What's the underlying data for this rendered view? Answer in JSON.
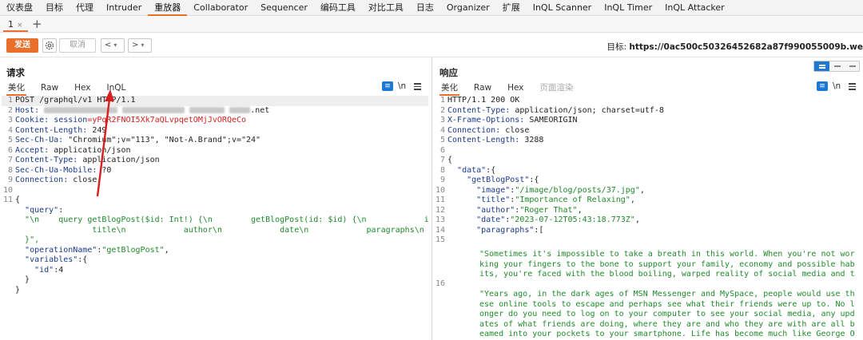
{
  "menu": [
    {
      "label": "仪表盘"
    },
    {
      "label": "目标"
    },
    {
      "label": "代理"
    },
    {
      "label": "Intruder"
    },
    {
      "label": "重放器",
      "active": true
    },
    {
      "label": "Collaborator"
    },
    {
      "label": "Sequencer"
    },
    {
      "label": "编码工具"
    },
    {
      "label": "对比工具"
    },
    {
      "label": "日志"
    },
    {
      "label": "Organizer"
    },
    {
      "label": "扩展"
    },
    {
      "label": "InQL Scanner"
    },
    {
      "label": "InQL Timer"
    },
    {
      "label": "InQL Attacker"
    }
  ],
  "request_tabs": {
    "tab1": "1",
    "close": "×",
    "add": "+"
  },
  "toolbar": {
    "send": "发送",
    "cancel": "取消",
    "back": "<",
    "forward": ">",
    "dropdown": "▾",
    "target_label": "目标:",
    "target_value": "https://0ac500c50326452682a87f990055009b.we"
  },
  "request": {
    "title": "请求",
    "tabs": [
      "美化",
      "Raw",
      "Hex",
      "InQL"
    ],
    "active_tab": "美化",
    "tool_n": "\\n",
    "lines": {
      "l1": "POST /graphql/v1 HTTP/1.1",
      "l2_key": "Host:",
      "l2_val": ".net",
      "l3_key": "Cookie:",
      "l3_cookie_name": "session",
      "l3_cookie_val": "=yPqR2FNOI5Xk7aQLvpqetOMjJvORQeCo",
      "l4_key": "Content-Length:",
      "l4_val": "249",
      "l5_key": "Sec-Ch-Ua:",
      "l5_val": "\"Chromium\";v=\"113\", \"Not-A.Brand\";v=\"24\"",
      "l6_key": "Accept:",
      "l6_val": "application/json",
      "l7_key": "Content-Type:",
      "l7_val": "application/json",
      "l8_key": "Sec-Ch-Ua-Mobile:",
      "l8_val": "?0",
      "l9_key": "Connection:",
      "l9_val": "close",
      "l11_open": "{",
      "query_key": "\"query\"",
      "query_line1": "\"\\n    query getBlogPost($id: Int!) {\\n        getBlogPost(id: $id) {\\n            image\\n",
      "query_line2": "            title\\n            author\\n            date\\n            paragraphs\\n        }\\n",
      "query_line3": "}\",",
      "opname_key": "\"operationName\"",
      "opname_val": "\"getBlogPost\"",
      "variables_key": "\"variables\"",
      "id_key": "\"id\"",
      "id_val": "4",
      "close_inner": "}",
      "close_outer": "}"
    }
  },
  "response": {
    "title": "响应",
    "tabs": [
      "美化",
      "Raw",
      "Hex",
      "页面渲染"
    ],
    "active_tab": "美化",
    "tool_n": "\\n",
    "lines": {
      "l1": "HTTP/1.1 200 OK",
      "l2_key": "Content-Type:",
      "l2_val": "application/json; charset=utf-8",
      "l3_key": "X-Frame-Options:",
      "l3_val": "SAMEORIGIN",
      "l4_key": "Connection:",
      "l4_val": "close",
      "l5_key": "Content-Length:",
      "l5_val": "3288",
      "l7": "{",
      "data_key": "\"data\"",
      "gbp_key": "\"getBlogPost\"",
      "image_key": "\"image\"",
      "image_val": "\"/image/blog/posts/37.jpg\"",
      "title_key": "\"title\"",
      "title_val": "\"Importance of Relaxing\"",
      "author_key": "\"author\"",
      "author_val": "\"Roger That\"",
      "date_key": "\"date\"",
      "date_val": "\"2023-07-12T05:43:18.773Z\"",
      "paragraphs_key": "\"paragraphs\"",
      "para1": "\"Sometimes it's impossible to take a breath in this world. When you're not working your fingers to the bone to support your family, economy and possible habits, you're faced with the blood boiling, warped reality of social media and the internet in general.\",",
      "para2": "\"Years ago, in the dark ages of MSN Messenger and MySpace, people would use these online tools to escape and perhaps see what their friends were up to. No longer do you need to log on to your computer to see your social media, any updates of what friends are doing, where they are and who they are with are all beamed into your pockets to your smartphone. Life has become much like George Orwell predicted, Big Brother is watching you,"
    }
  }
}
